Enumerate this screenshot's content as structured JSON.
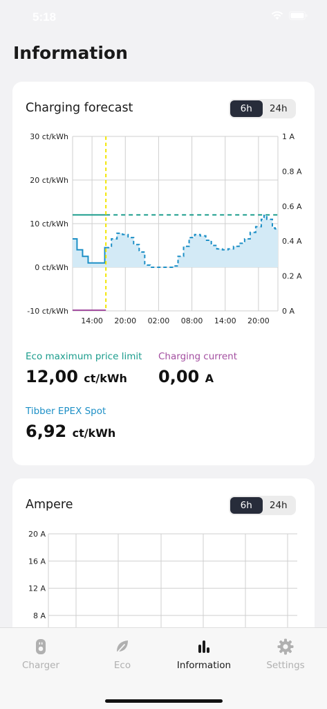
{
  "status_bar": {
    "time": "5:18"
  },
  "page_title": "Information",
  "forecast": {
    "title": "Charging forecast",
    "range_options": [
      "6h",
      "24h"
    ],
    "selected_range": "6h",
    "eco_limit": {
      "label": "Eco maximum price limit",
      "value": "12,00",
      "unit": "ct/kWh",
      "color": "#1a9c8c"
    },
    "charging_current": {
      "label": "Charging current",
      "value": "0,00",
      "unit": "A",
      "color": "#a34ea0"
    },
    "spot": {
      "label": "Tibber EPEX Spot",
      "value": "6,92",
      "unit": "ct/kWh",
      "color": "#1c8fc6"
    }
  },
  "ampere": {
    "title": "Ampere",
    "range_options": [
      "6h",
      "24h"
    ],
    "selected_range": "6h"
  },
  "chart_data": [
    {
      "type": "line",
      "y_left": {
        "unit": "ct/kWh",
        "ticks": [
          "30 ct/kWh",
          "20 ct/kWh",
          "10 ct/kWh",
          "0 ct/kWh",
          "-10 ct/kWh"
        ],
        "range": [
          -10,
          30
        ]
      },
      "y_right": {
        "unit": "A",
        "ticks": [
          "1 A",
          "0.8 A",
          "0.6 A",
          "0.4 A",
          "0.2 A",
          "0 A"
        ],
        "range": [
          0,
          1
        ]
      },
      "x_ticks": [
        "14:00",
        "20:00",
        "02:00",
        "08:00",
        "14:00",
        "20:00"
      ],
      "x_tick_hours": [
        14,
        20,
        26,
        32,
        38,
        44
      ],
      "x_range_hours": [
        10.5,
        47.5
      ],
      "now_hour": 16.5,
      "grid": true,
      "series": [
        {
          "color": "#1c8fc6",
          "style": "step-area",
          "past": [
            [
              10.5,
              6.5
            ],
            [
              11.3,
              4.0
            ],
            [
              12.3,
              2.5
            ],
            [
              13.3,
              1.0
            ],
            [
              14.3,
              1.0
            ],
            [
              15.3,
              1.0
            ],
            [
              16.3,
              4.5
            ],
            [
              16.5,
              4.5
            ]
          ],
          "forecast": [
            [
              16.5,
              4.5
            ],
            [
              17.5,
              6.5
            ],
            [
              18.5,
              7.8
            ],
            [
              19.5,
              7.5
            ],
            [
              20.5,
              6.8
            ],
            [
              21.5,
              5.2
            ],
            [
              22.5,
              3.5
            ],
            [
              23.5,
              0.5
            ],
            [
              24.5,
              0.0
            ],
            [
              25.5,
              0.0
            ],
            [
              26.5,
              0.0
            ],
            [
              27.5,
              0.0
            ],
            [
              28.5,
              0.3
            ],
            [
              29.5,
              2.5
            ],
            [
              30.5,
              4.8
            ],
            [
              31.5,
              6.8
            ],
            [
              32.5,
              7.5
            ],
            [
              33.5,
              7.2
            ],
            [
              34.5,
              6.2
            ],
            [
              35.5,
              5.0
            ],
            [
              36.5,
              4.2
            ],
            [
              37.5,
              4.0
            ],
            [
              38.5,
              4.2
            ],
            [
              39.5,
              4.8
            ],
            [
              40.5,
              5.5
            ],
            [
              41.5,
              6.5
            ],
            [
              42.5,
              8.0
            ],
            [
              43.5,
              9.3
            ],
            [
              44.5,
              11.0
            ],
            [
              45.0,
              11.9
            ],
            [
              45.5,
              11.0
            ],
            [
              46.5,
              9.0
            ],
            [
              47.0,
              8.8
            ],
            [
              47.5,
              8.8
            ]
          ]
        },
        {
          "color": "#1a9c8c",
          "style": "eco-limit",
          "past": [
            [
              10.5,
              12
            ],
            [
              16.5,
              12
            ]
          ],
          "forecast": [
            [
              16.5,
              12
            ],
            [
              47.5,
              12
            ]
          ]
        },
        {
          "color": "#a34ea0",
          "style": "charging-current",
          "past": [
            [
              10.5,
              0
            ],
            [
              16.5,
              0
            ]
          ]
        }
      ]
    },
    {
      "type": "line",
      "y_left": {
        "unit": "A",
        "ticks": [
          "20 A",
          "16 A",
          "12 A",
          "8 A"
        ],
        "range": [
          4,
          20
        ]
      },
      "grid": true,
      "series": []
    }
  ]
}
